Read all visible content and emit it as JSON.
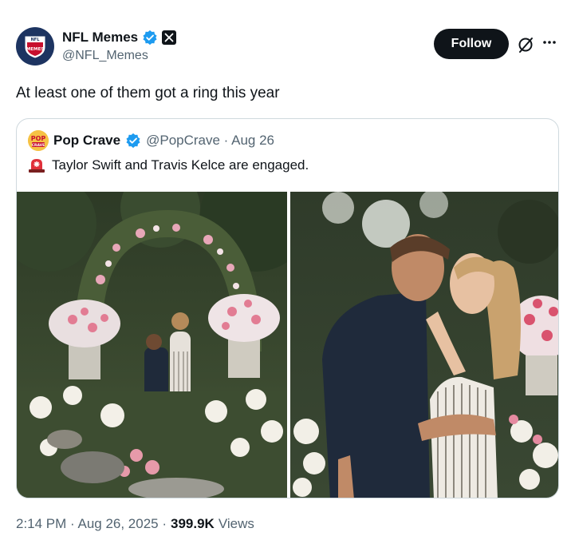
{
  "author": {
    "display_name": "NFL Memes",
    "handle": "@NFL_Memes",
    "avatar_text": "NFL MEMES"
  },
  "follow_label": "Follow",
  "tweet_text": "At least one of them got a ring this year",
  "quoted": {
    "display_name": "Pop Crave",
    "handle_and_date": "@PopCrave · Aug 26",
    "avatar_text": "POP CRAVE",
    "text": "Taylor Swift and Travis Kelce are engaged."
  },
  "meta": {
    "time_date": "2:14 PM · Aug 26, 2025 ·",
    "views_count": "399.9K",
    "views_label": "Views"
  },
  "icons": {
    "verified": "verified-badge-icon",
    "x_affiliate": "x-affiliate-icon",
    "grok": "grok-icon",
    "more": "more-icon",
    "siren": "siren-emoji"
  },
  "colors": {
    "verified_blue": "#1d9bf0",
    "follow_bg": "#0f1419",
    "muted": "#536471"
  }
}
